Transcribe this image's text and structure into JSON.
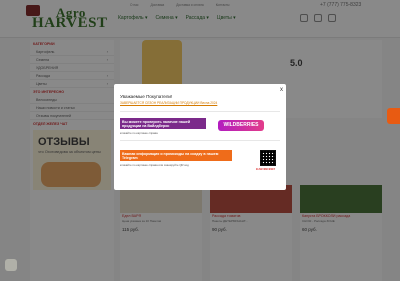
{
  "header": {
    "logo_top": "Agro",
    "logo_bottom": "HARVEST",
    "top_nav": [
      "О нас",
      "Доставка",
      "Доставка и оплата",
      "Контакты",
      "Отзывы",
      "Контакты"
    ],
    "phone": "+7 (777) 775-8323",
    "categories": [
      "Картофель ▾",
      "Семена ▾",
      "Рассада ▾",
      "Цветы ▾"
    ]
  },
  "sidebar": {
    "catalog_heading": "КАТЕГОРИИ",
    "items": [
      "Картофель",
      "Семена",
      "УДОБРЕНИЯ",
      "Рассада",
      "Цветы"
    ],
    "info_heading": "ЭТО ИНТЕРЕСНО",
    "info_items": [
      "Велосипеды",
      "Наши новости и статьи",
      "Отзывы покупателей"
    ],
    "reviews_heading": "ОТДЕЛ ЖЕЛЕЗ ЧАТ",
    "promo_title": "ОТЗЫВЫ",
    "promo_sub": "что Охотоведова за объектом цены"
  },
  "banner": {
    "rating": "5.0"
  },
  "products": [
    {
      "name": "Едел ВАРЯ",
      "desc": "Цена указана за 10 Пакетов",
      "price": "115 руб."
    },
    {
      "name": "Рассада томатов",
      "desc": "Пакеты ДЕТЕРМИНАНТ...",
      "price": "90 руб."
    },
    {
      "name": "Капуста БРОККОЛИ рассада",
      "desc": "СНОЖ - Рассада ЗОНЕ",
      "price": "60 руб."
    }
  ],
  "modal": {
    "title": "Уважаемые Покупатели!",
    "link1": "ЗАВЕРШАЕТСЯ СЕЗОН РЕАЛИЗАЦИИ ПРОДУКЦИИ Весна 2024",
    "wb_text": "Вы можете проверить наличие нашей продукции на Вайлдберис",
    "wb_note": "кликайте по картинке справа",
    "wb_logo": "WILDBERRIES",
    "tg_text": "Важная информация и промокоды на скидку в нашем Telegram",
    "tg_note": "кликайте по картинке справа или сканируйте QR код",
    "qr_label": "ELSEVENCESEY",
    "close": "x"
  }
}
